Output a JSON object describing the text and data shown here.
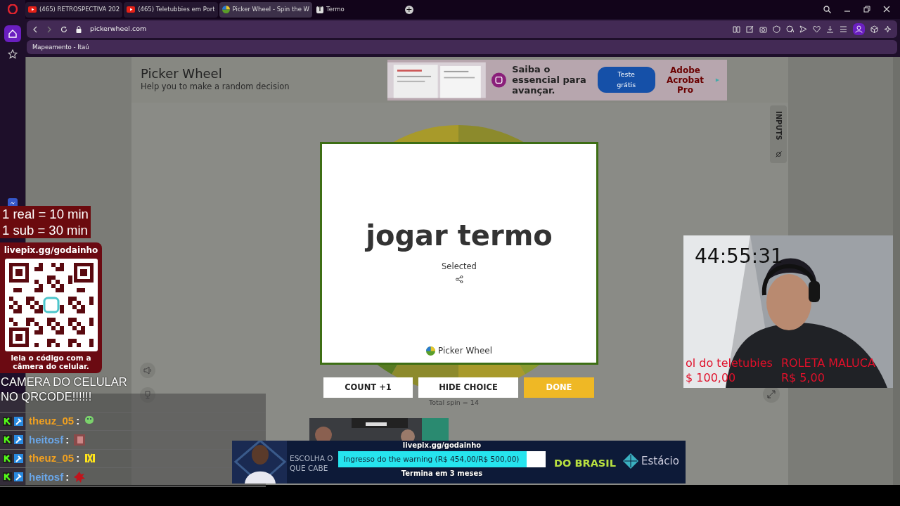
{
  "browser": {
    "tabs": [
      {
        "label": "(465) RETROSPECTIVA 202",
        "kind": "youtube",
        "selected": false
      },
      {
        "label": "(465) Teletubbies em Port",
        "kind": "youtube",
        "selected": false
      },
      {
        "label": "Picker Wheel - Spin the W",
        "kind": "wheel",
        "selected": true
      },
      {
        "label": "Termo",
        "kind": "letter",
        "icon_text": "T",
        "selected": false
      }
    ],
    "new_tab": "+",
    "address": "pickerwheel.com",
    "bookmarks": [
      "Mapeamento - Itaú"
    ]
  },
  "site": {
    "title": "Picker Wheel",
    "subtitle": "Help you to make a random decision",
    "inputs_tab": "INPUTS",
    "total_spin": "Total spin = 14"
  },
  "ad_top": {
    "headline": "Saiba o essencial para avançar.",
    "button": "Teste grátis",
    "brand": "Adobe Acrobat Pro"
  },
  "result_modal": {
    "result": "jogar termo",
    "caption": "Selected",
    "footer": "Picker Wheel"
  },
  "actions": [
    {
      "label": "COUNT +1",
      "kind": "plain"
    },
    {
      "label": "HIDE CHOICE",
      "kind": "plain"
    },
    {
      "label": "DONE",
      "kind": "primary"
    }
  ],
  "overlay": {
    "rates": [
      "1 real = 10 min",
      "1 sub = 30 min"
    ],
    "qr_title": "livepix.gg/godainho",
    "qr_caption": "leia o código com a câmera do celular.",
    "shout": [
      "CAMERA DO CELULAR",
      "NO QRCODE!!!!!!"
    ],
    "chat": [
      {
        "user": "theuz_05",
        "sep": ":",
        "color": "#f0a020"
      },
      {
        "user": "heitosf",
        "sep": ":",
        "color": "#6aa6e8"
      },
      {
        "user": "theuz_05",
        "sep": ":",
        "color": "#f0a020"
      },
      {
        "user": "heitosf",
        "sep": ":",
        "color": "#6aa6e8"
      }
    ],
    "timer": "44:55:31",
    "prizes": [
      {
        "name": "ol do teletubies",
        "price": "$ 100,00"
      },
      {
        "name": "ROLETA MALUCA",
        "price": "R$ 5,00"
      }
    ],
    "goal": {
      "link": "livepix.gg/godainho",
      "label": "Ingresso do the warning (R$ 454,00/R$ 500,00)",
      "level": 0.908,
      "ends": "Termina em 3 meses"
    }
  },
  "ad_bottom": {
    "lines": [
      "ESCOLHA O",
      "QUE CABE"
    ],
    "slogan": "DO BRASIL",
    "brand": "Estácio"
  }
}
